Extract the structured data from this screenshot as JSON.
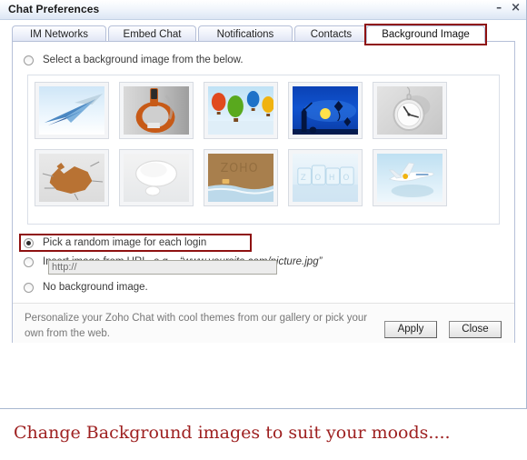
{
  "window": {
    "title": "Chat Preferences",
    "minimize_label": "–",
    "close_label": "×"
  },
  "tabs": [
    {
      "label": "IM Networks",
      "active": false
    },
    {
      "label": "Embed Chat",
      "active": false
    },
    {
      "label": "Notifications",
      "active": false
    },
    {
      "label": "Contacts",
      "active": false
    },
    {
      "label": "Background Image",
      "active": true,
      "highlighted": true
    }
  ],
  "options": {
    "select_from_below": {
      "label": "Select a background image from the below.",
      "checked": false
    },
    "random_each_login": {
      "label": "Pick a random image for each login",
      "checked": true,
      "highlighted": true
    },
    "insert_from_url": {
      "label_plain": "Insert image from URL, e.g.,, ",
      "label_italic": "“www.yoursite.com/picture.jpg”",
      "checked": false
    },
    "no_background": {
      "label": "No background image.",
      "checked": false
    }
  },
  "url_field": {
    "value": "",
    "placeholder": "http://"
  },
  "gallery": {
    "thumbnails": [
      {
        "name": "paper-airplane",
        "alt": "Blue paper airplane on light blue sky"
      },
      {
        "name": "electric-guitar",
        "alt": "Orange electric guitar on gray background"
      },
      {
        "name": "hot-air-balloons",
        "alt": "Colorful hot air balloons in sky"
      },
      {
        "name": "kite-flying-silhouette",
        "alt": "Silhouettes flying kites against deep blue night sky with moon"
      },
      {
        "name": "pocket-watch",
        "alt": "White pocket watch clock on gray background"
      },
      {
        "name": "cracked-earth",
        "alt": "Brown cracked mud on gray surface"
      },
      {
        "name": "speech-bubble",
        "alt": "Glossy white speech bubble"
      },
      {
        "name": "zoho-sand",
        "alt": "ZOHO written in brown sand near water"
      },
      {
        "name": "zoho-ice-cubes",
        "alt": "ZOHO spelled out in ice cubes"
      },
      {
        "name": "jet-airplane",
        "alt": "White private jet flying in blue sky"
      }
    ]
  },
  "footer": {
    "description": "Personalize your Zoho Chat with cool themes from our gallery or pick your own from the web.",
    "apply_label": "Apply",
    "close_label": "Close"
  },
  "caption": {
    "text": "Change Background images to suit your moods....",
    "color": "#9e2020"
  },
  "accent_colors": {
    "highlight_red": "#8e1111",
    "tab_border": "#b6c0d8",
    "caption_red": "#9e2020"
  }
}
